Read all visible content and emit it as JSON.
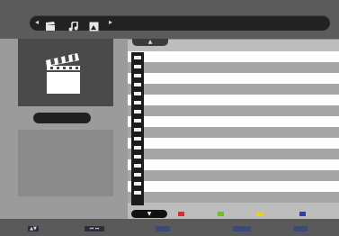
{
  "nav": {
    "left_arrow": "◂",
    "right_arrow": "▸",
    "icons": [
      "clapperboard-icon",
      "music-note-icon",
      "photo-icon"
    ]
  },
  "scroll": {
    "up": "▲",
    "down": "▼"
  },
  "color_keys": [
    "#e02a2a",
    "#6ec21f",
    "#e8d21a",
    "#2a3fb8"
  ],
  "bottom": {
    "updown": "▲▼",
    "skip": "⏮ ⏭"
  }
}
